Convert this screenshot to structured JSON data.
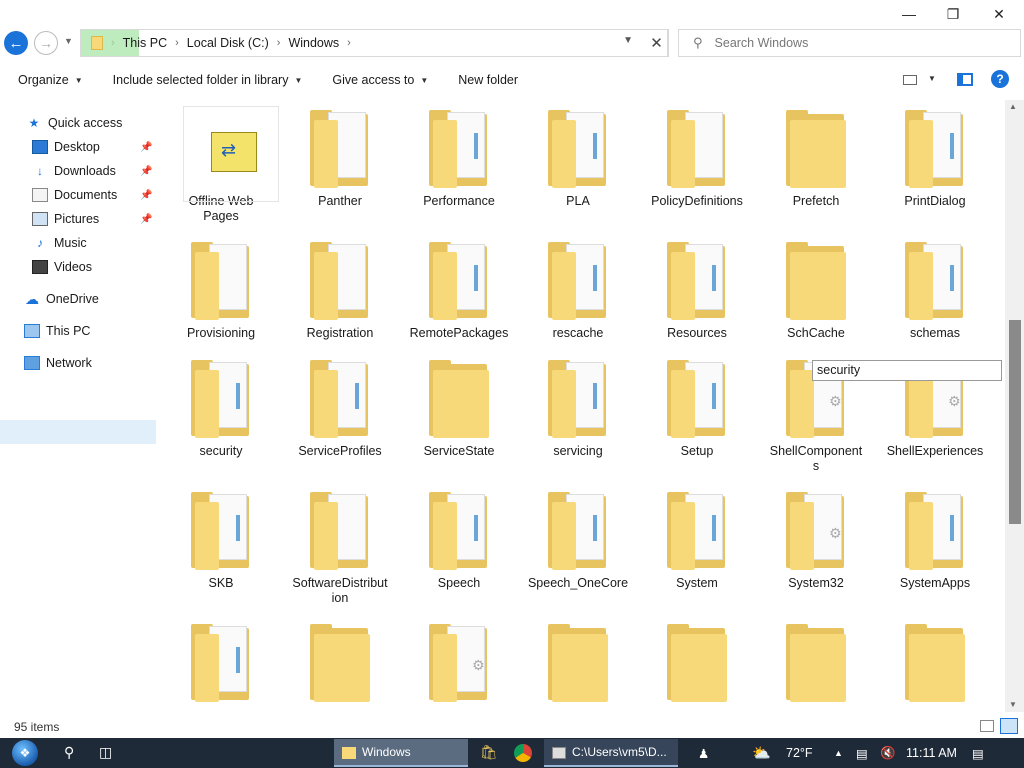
{
  "titlebar": {
    "minimize_icon": "minimize-icon",
    "restore_icon": "restore-icon",
    "close_icon": "close-icon"
  },
  "address": {
    "crumbs": [
      "This PC",
      "Local Disk (C:)",
      "Windows"
    ],
    "search_placeholder": "Search Windows"
  },
  "commands": {
    "organize": "Organize",
    "include": "Include selected folder in library",
    "share": "Give access to",
    "new_folder": "New folder"
  },
  "nav": {
    "quick_access": "Quick access",
    "desktop": "Desktop",
    "downloads": "Downloads",
    "documents": "Documents",
    "pictures": "Pictures",
    "music": "Music",
    "videos": "Videos",
    "onedrive": "OneDrive",
    "this_pc": "This PC",
    "network": "Network"
  },
  "folders": [
    {
      "label": "Offline Web\nPages",
      "type": "special"
    },
    {
      "label": "Panther",
      "type": "paper"
    },
    {
      "label": "Performance",
      "type": "doc"
    },
    {
      "label": "PLA",
      "type": "doc"
    },
    {
      "label": "PolicyDefinitions",
      "type": "paper"
    },
    {
      "label": "Prefetch",
      "type": "plain"
    },
    {
      "label": "PrintDialog",
      "type": "doc"
    },
    {
      "label": "Provisioning",
      "type": "paper"
    },
    {
      "label": "Registration",
      "type": "paper"
    },
    {
      "label": "RemotePackages",
      "type": "doc"
    },
    {
      "label": "rescache",
      "type": "doc"
    },
    {
      "label": "Resources",
      "type": "doc"
    },
    {
      "label": "SchCache",
      "type": "plain"
    },
    {
      "label": "schemas",
      "type": "doc"
    },
    {
      "label": "security",
      "type": "doc"
    },
    {
      "label": "ServiceProfiles",
      "type": "doc"
    },
    {
      "label": "ServiceState",
      "type": "plain"
    },
    {
      "label": "servicing",
      "type": "doc"
    },
    {
      "label": "Setup",
      "type": "doc"
    },
    {
      "label": "ShellComponent\ns",
      "type": "gear"
    },
    {
      "label": "ShellExperiences",
      "type": "gear"
    },
    {
      "label": "SKB",
      "type": "doc"
    },
    {
      "label": "SoftwareDistribut\nion",
      "type": "paper"
    },
    {
      "label": "Speech",
      "type": "doc"
    },
    {
      "label": "Speech_OneCore",
      "type": "doc"
    },
    {
      "label": "System",
      "type": "doc"
    },
    {
      "label": "System32",
      "type": "gear"
    },
    {
      "label": "SystemApps",
      "type": "doc"
    },
    {
      "label": "",
      "type": "doc"
    },
    {
      "label": "",
      "type": "plain"
    },
    {
      "label": "",
      "type": "gear"
    },
    {
      "label": "",
      "type": "plain"
    },
    {
      "label": "",
      "type": "plain"
    },
    {
      "label": "",
      "type": "plain"
    },
    {
      "label": "",
      "type": "plain"
    }
  ],
  "rename_value": "security",
  "status": {
    "item_count": "95 items"
  },
  "taskbar": {
    "explorer_label": "Windows",
    "cmd_label": "C:\\Users\\vm5\\D...",
    "weather": "72°F",
    "time": "11:11 AM"
  },
  "colors": {
    "accent": "#1a73d9",
    "folder": "#f7d97a",
    "taskbar": "#1f2a38"
  }
}
